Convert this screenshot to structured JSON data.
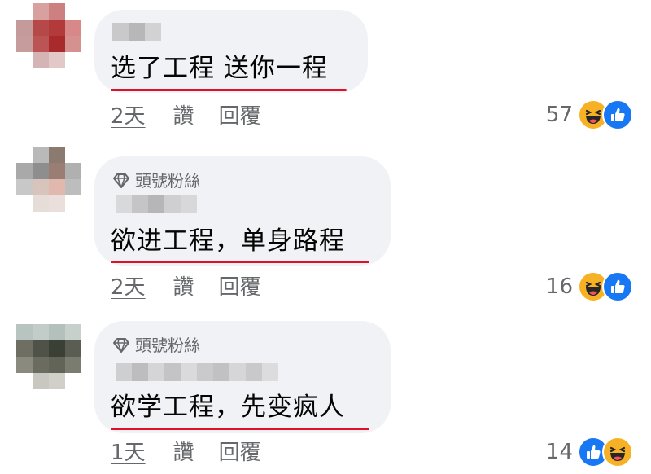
{
  "comments": [
    {
      "badge": "",
      "text": "选了工程 送你一程",
      "time": "2天",
      "like": "讚",
      "reply": "回覆",
      "reaction_count": "57",
      "reaction_order": [
        "haha-icon",
        "like-icon"
      ]
    },
    {
      "badge": "頭號粉絲",
      "text": "欲进工程，单身路程",
      "time": "2天",
      "like": "讚",
      "reply": "回覆",
      "reaction_count": "16",
      "reaction_order": [
        "haha-icon",
        "like-icon"
      ]
    },
    {
      "badge": "頭號粉絲",
      "text": "欲学工程，先变疯人",
      "time": "1天",
      "like": "讚",
      "reply": "回覆",
      "reaction_count": "14",
      "reaction_order": [
        "like-icon",
        "haha-icon"
      ]
    }
  ],
  "colors": {
    "bubble": "#f0f2f5",
    "secondary_text": "#65676b",
    "underline": "#e0102a",
    "like_blue": "#1877f2",
    "haha_yellow": "#f7b125"
  }
}
